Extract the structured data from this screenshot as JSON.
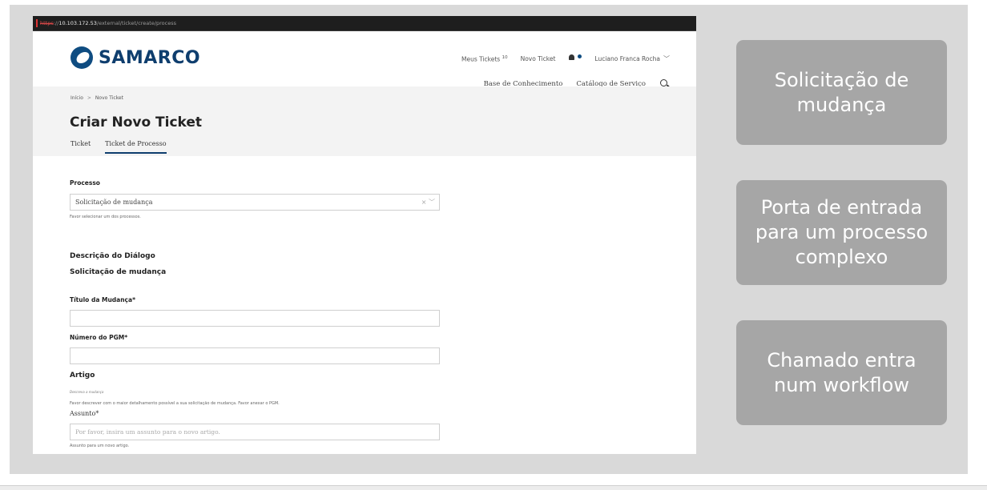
{
  "browser": {
    "url_protocol": "https",
    "url_host": "10.103.172.53",
    "url_path": "/external/ticket/create/process"
  },
  "header": {
    "logo_text": "SAMARCO",
    "top_nav": {
      "my_tickets": "Meus Tickets",
      "my_tickets_count": "10",
      "new_ticket": "Novo Ticket",
      "user": "Luciano Franca Rocha"
    },
    "secondary_nav": {
      "knowledge_base": "Base de Conhecimento",
      "service_catalog": "Catálogo de Serviço"
    }
  },
  "breadcrumb": {
    "home": "Início",
    "current": "Novo Ticket"
  },
  "page": {
    "title": "Criar Novo Ticket",
    "tabs": [
      "Ticket",
      "Ticket de Processo"
    ],
    "active_tab": "Ticket de Processo"
  },
  "form": {
    "process_label": "Processo",
    "process_value": "Solicitação de mudança",
    "process_hint": "Favor selecionar um dos processos.",
    "dialog_description_title": "Descrição do Diálogo",
    "dialog_description_value": "Solicitação de mudança",
    "change_title_label": "Título da Mudança*",
    "pgm_label": "Número do PGM*",
    "article_title": "Artigo",
    "article_small": "Descreva a mudança",
    "article_hint": "Favor descrever com o maior detalhamento possível a sua solicitação de mudança. Favor anexar o PGM.",
    "subject_label": "Assunto*",
    "subject_placeholder": "Por favor, insira um assunto para o novo artigo.",
    "subject_hint": "Assunto para um novo artigo."
  },
  "callouts": [
    "Solicitação de\nmudança",
    "Porta de entrada\npara um processo\ncomplexo",
    "Chamado entra\nnum workflow"
  ],
  "colors": {
    "slide_background": "#d9d9d9",
    "callout_background": "#a6a6a6",
    "brand_blue": "#0f3e6e"
  }
}
